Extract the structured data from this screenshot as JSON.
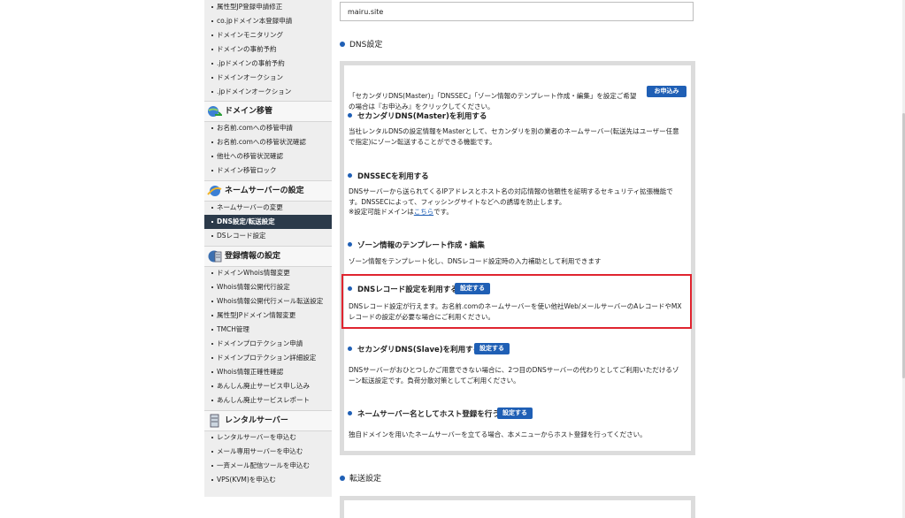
{
  "sidebar": {
    "top_items": [
      "属性型JP登録申請修正",
      "co.jpドメイン本登録申請",
      "ドメインモニタリング",
      "ドメインの事前予約",
      ".jpドメインの事前予約",
      "ドメインオークション",
      ".jpドメインオークション"
    ],
    "section_transfer": {
      "title": "ドメイン移管",
      "items": [
        "お名前.comへの移管申請",
        "お名前.comへの移管状況確認",
        "他社への移管状況確認",
        "ドメイン移管ロック"
      ]
    },
    "section_nameserver": {
      "title": "ネームサーバーの設定",
      "items": [
        "ネームサーバーの変更",
        "DNS設定/転送設定",
        "DSレコード設定"
      ]
    },
    "section_registration": {
      "title": "登録情報の設定",
      "items": [
        "ドメインWhois情報変更",
        "Whois情報公開代行設定",
        "Whois情報公開代行メール転送設定",
        "属性型JPドメイン情報変更",
        "TMCH管理",
        "ドメインプロテクション申請",
        "ドメインプロテクション詳細設定",
        "Whois情報正確性確認",
        "あんしん廃止サービス申し込み",
        "あんしん廃止サービスレポート"
      ]
    },
    "section_rental": {
      "title": "レンタルサーバー",
      "items": [
        "レンタルサーバーを申込む",
        "メール専用サーバーを申込む",
        "一斉メール配信ツールを申込む",
        "VPS(KVM)を申込む"
      ]
    },
    "active_item": "DNS設定/転送設定"
  },
  "main": {
    "domain_value": "mairu.site",
    "dns_section_title": "DNS設定",
    "intro_text": "「セカンダリDNS(Master)」「DNSSEC」「ゾーン情報のテンプレート作成・編集」を設定ご希望の場合は『お申込み』をクリックしてください。",
    "apply_button": "お申込み",
    "blocks": {
      "secondary_master": {
        "title": "セカンダリDNS(Master)を利用する",
        "desc": "当社レンタルDNSの設定情報をMasterとして、セカンダリを別の業者のネームサーバー(転送先はユーザー任意で指定)にゾーン転送することができる機能です。"
      },
      "dnssec": {
        "title": "DNSSECを利用する",
        "desc": "DNSサーバーから送られてくるIPアドレスとホスト名の対応情報の信頼性を証明するセキュリティ拡張機能です。DNSSECによって、フィッシングサイトなどへの誘導を防止します。",
        "note_prefix": "※設定可能ドメインは",
        "note_link": "こちら",
        "note_suffix": "です。"
      },
      "zone_template": {
        "title": "ゾーン情報のテンプレート作成・編集",
        "desc": "ゾーン情報をテンプレート化し、DNSレコード設定時の入力補助として利用できます"
      },
      "dns_record": {
        "title": "DNSレコード設定を利用する",
        "button": "設定する",
        "desc": "DNSレコード設定が行えます。お名前.comのネームサーバーを使い他社Web/メールサーバーのAレコードやMXレコードの設定が必要な場合にご利用ください。"
      },
      "secondary_slave": {
        "title": "セカンダリDNS(Slave)を利用する",
        "button": "設定する",
        "desc": "DNSサーバーがおひとつしかご用意できない場合に、2つ目のDNSサーバーの代わりとしてご利用いただけるゾーン転送設定です。負荷分散対策としてご利用ください。"
      },
      "host_registration": {
        "title": "ネームサーバー名としてホスト登録を行う",
        "button": "設定する",
        "desc": "独自ドメインを用いたネームサーバーを立てる場合、本メニューからホスト登録を行ってください。"
      }
    },
    "forward_section_title": "転送設定"
  },
  "colors": {
    "accent": "#1f5fb5",
    "highlight": "#e0242f",
    "sidebar_bg": "#eeeeee",
    "active_bg": "#2b3a4a"
  }
}
